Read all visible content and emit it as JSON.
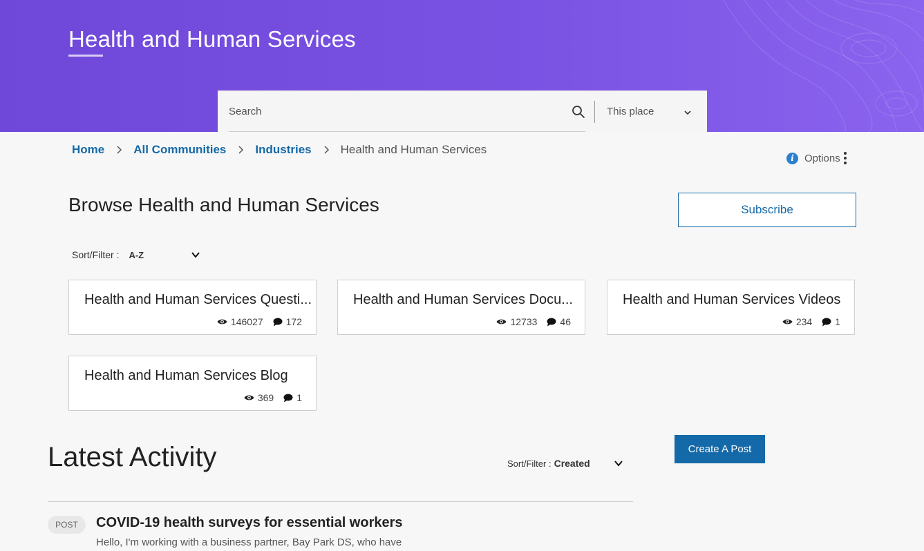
{
  "hero": {
    "title": "Health and Human Services"
  },
  "search": {
    "placeholder": "Search",
    "scope": "This place"
  },
  "breadcrumb": {
    "links": [
      "Home",
      "All Communities",
      "Industries"
    ],
    "current": "Health and Human Services"
  },
  "options": {
    "label": "Options"
  },
  "browse": {
    "title": "Browse Health and Human Services",
    "subscribe_label": "Subscribe",
    "sort_label": "Sort/Filter :",
    "sort_value": "A-Z",
    "cards": [
      {
        "title": "Health and Human Services Questi...",
        "views": "146027",
        "replies": "172"
      },
      {
        "title": "Health and Human Services Docu...",
        "views": "12733",
        "replies": "46"
      },
      {
        "title": "Health and Human Services Videos",
        "views": "234",
        "replies": "1"
      },
      {
        "title": "Health and Human Services Blog",
        "views": "369",
        "replies": "1"
      }
    ]
  },
  "latest": {
    "title": "Latest Activity",
    "sort_label": "Sort/Filter :",
    "sort_value": "Created",
    "create_label": "Create A Post",
    "post": {
      "badge": "POST",
      "title": "COVID-19 health surveys for essential workers",
      "snippet": "Hello, I'm working with a business partner, Bay Park DS, who have"
    }
  },
  "colors": {
    "hero": "#7a52e3",
    "accent": "#1469a8"
  },
  "icons": {
    "search": "search-icon",
    "chevron": "chevron-down-icon",
    "crumb": "chevron-right-icon",
    "info": "info-icon",
    "kebab": "kebab-icon",
    "views": "eye-icon",
    "replies": "comment-icon"
  }
}
